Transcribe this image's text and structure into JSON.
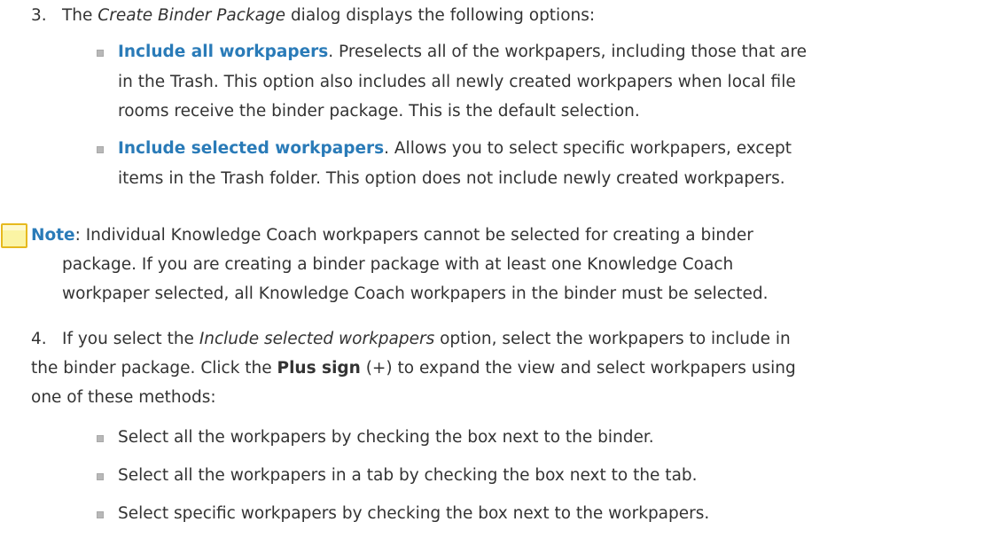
{
  "step3": {
    "number": "3.",
    "prefix": "The ",
    "dialog_name": "Create Binder Package",
    "suffix": " dialog displays the following options:",
    "options": [
      {
        "term": "Include all workpapers",
        "lines": [
          ". Preselects all of the workpapers, including those that are",
          "in the Trash. This option also includes all newly created workpapers when local file",
          "rooms receive the binder package. This is the default selection."
        ]
      },
      {
        "term": "Include selected workpapers",
        "lines": [
          ". Allows you to select specific workpapers, except",
          "items in the Trash folder. This option does not include newly created workpapers."
        ]
      }
    ],
    "note": {
      "label": "Note",
      "lines": [
        ": Individual Knowledge Coach workpapers cannot be selected for creating a binder",
        "package. If you are creating a binder package with at least one Knowledge Coach",
        "workpaper selected, all Knowledge Coach workpapers in the binder must be selected."
      ]
    }
  },
  "step4": {
    "number": "4.",
    "line1_prefix": "If you select the ",
    "line1_option": "Include selected workpapers",
    "line1_suffix": " option, select the workpapers to include in",
    "line2_prefix": "the binder package. Click the ",
    "line2_bold": "Plus sign",
    "line2_suffix": " (+) to expand the view and select workpapers using",
    "line3": "one of these methods:",
    "methods": [
      "Select all the workpapers by checking the box next to the binder.",
      "Select all the workpapers in a tab by checking the box next to the tab.",
      "Select specific workpapers by checking the box next to the workpapers."
    ]
  }
}
